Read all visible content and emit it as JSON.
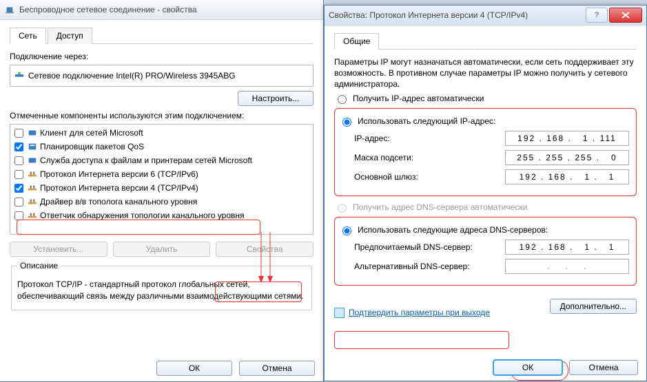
{
  "left": {
    "title": "Беспроводное сетевое соединение - свойства",
    "tabs": {
      "network": "Сеть",
      "access": "Доступ"
    },
    "connect_via_label": "Подключение через:",
    "adapter": "Сетевое подключение Intel(R) PRO/Wireless 3945ABG",
    "configure_btn": "Настроить...",
    "components_label": "Отмеченные компоненты используются этим подключением:",
    "components": [
      {
        "checked": false,
        "label": "Клиент для сетей Microsoft"
      },
      {
        "checked": true,
        "label": "Планировщик пакетов QoS"
      },
      {
        "checked": false,
        "label": "Служба доступа к файлам и принтерам сетей Microsoft"
      },
      {
        "checked": false,
        "label": "Протокол Интернета версии 6 (TCP/IPv6)"
      },
      {
        "checked": true,
        "label": "Протокол Интернета версии 4 (TCP/IPv4)"
      },
      {
        "checked": false,
        "label": "Драйвер в/в тополога канального уровня"
      },
      {
        "checked": false,
        "label": "Ответчик обнаружения топологии канального уровня"
      }
    ],
    "install_btn": "Установить...",
    "remove_btn": "Удалить",
    "props_btn": "Свойства",
    "desc_legend": "Описание",
    "desc_text": "Протокол TCP/IP - стандартный протокол глобальных сетей, обеспечивающий связь между различными взаимодействующими сетями.",
    "ok_btn": "ОК",
    "cancel_btn": "Отмена"
  },
  "right": {
    "title": "Свойства: Протокол Интернета версии 4 (TCP/IPv4)",
    "tab": "Общие",
    "intro": "Параметры IP могут назначаться автоматически, если сеть поддерживает эту возможность. В противном случае параметры IP можно получить у сетевого администратора.",
    "ip_auto": "Получить IP-адрес автоматически",
    "ip_manual": "Использовать следующий IP-адрес:",
    "ip_label": "IP-адрес:",
    "ip_value": "192 . 168 .   1 . 111",
    "mask_label": "Маска подсети:",
    "mask_value": "255 . 255 . 255 .   0",
    "gw_label": "Основной шлюз:",
    "gw_value": "192 . 168 .   1 .   1",
    "dns_auto": "Получить адрес DNS-сервера автоматически",
    "dns_manual": "Использовать следующие адреса DNS-серверов:",
    "dns1_label": "Предпочитаемый DNS-сервер:",
    "dns1_value": "192 . 168 .   1 .   1",
    "dns2_label": "Альтернативный DNS-сервер:",
    "dns2_value": "   .    .    .   ",
    "confirm_on_exit": "Подтвердить параметры при выходе",
    "advanced_btn": "Дополнительно...",
    "ok_btn": "ОК",
    "cancel_btn": "Отмена"
  }
}
